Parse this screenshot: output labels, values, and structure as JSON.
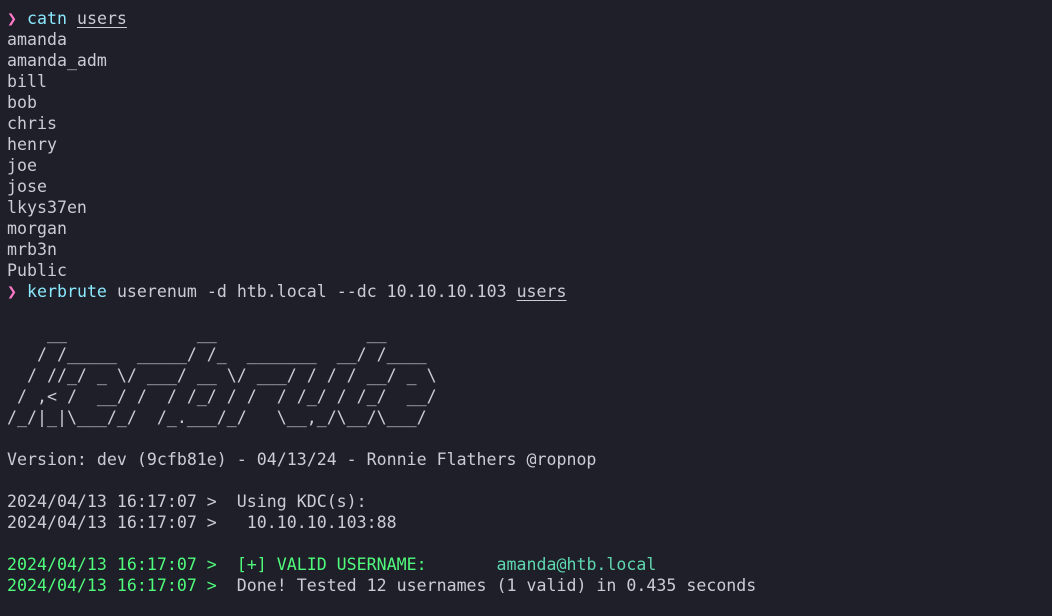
{
  "prompt_symbol": "❯",
  "cmd1": {
    "command": "catn",
    "arg": "users"
  },
  "users": [
    "amanda",
    "amanda_adm",
    "bill",
    "bob",
    "chris",
    "henry",
    "joe",
    "jose",
    "lkys37en",
    "morgan",
    "mrb3n",
    "Public"
  ],
  "cmd2": {
    "command": "kerbrute",
    "args": "userenum -d htb.local --dc 10.10.10.103",
    "arg_file": "users"
  },
  "banner": [
    "    __             __               __     ",
    "   / /_____  _____/ /_  _______  __/ /____ ",
    "  / //_/ _ \\/ ___/ __ \\/ ___/ / / / __/ _ \\",
    " / ,< /  __/ /  / /_/ / /  / /_/ / /_/  __/",
    "/_/|_|\\___/_/  /_.___/_/   \\__,_/\\__/\\___/ "
  ],
  "version_line": "Version: dev (9cfb81e) - 04/13/24 - Ronnie Flathers @ropnop",
  "log": [
    {
      "text": "2024/04/13 16:17:07 >  Using KDC(s):"
    },
    {
      "text": "2024/04/13 16:17:07 >   10.10.10.103:88"
    }
  ],
  "valid": {
    "prefix": "2024/04/13 16:17:07 >  [+] VALID USERNAME:       ",
    "user": "amanda@htb.local"
  },
  "done": {
    "prefix": "2024/04/13 16:17:07 >  ",
    "text": "Done! Tested 12 usernames (1 valid) in 0.435 seconds"
  },
  "colors": {
    "background": "#1e1f29",
    "prompt": "#ff79c6",
    "command": "#8be9fd",
    "success": "#50fa7b",
    "highlight": "#5fd7af",
    "text": "#c9cbd6"
  }
}
